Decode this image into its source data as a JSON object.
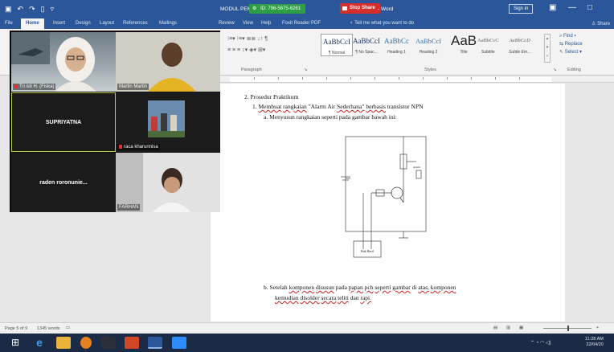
{
  "titlebar": {
    "doc_title": "MODUL PEMB",
    "zoom_pill": "ID: 796-5875-6261",
    "share_pill": "Stop Share",
    "word_suffix": "- Word",
    "signin": "Sign in",
    "minimize": "—",
    "restore": "□"
  },
  "tabs": [
    "File",
    "Home",
    "Insert",
    "Design",
    "Layout",
    "References",
    "Mailings",
    "Review",
    "View",
    "Help",
    "Foxit Reader PDF"
  ],
  "tellme": "Tell me what you want to do",
  "share": "Share",
  "ribbon": {
    "paragraph_label": "Paragraph",
    "styles_label": "Styles",
    "editing_label": "Editing",
    "styles": [
      {
        "sample": "AaBbCcI",
        "name": "¶ Normal"
      },
      {
        "sample": "AaBbCcI",
        "name": "¶ No Spac..."
      },
      {
        "sample": "AaBbCc",
        "name": "Heading 1"
      },
      {
        "sample": "AaBbCcI",
        "name": "Heading 2"
      },
      {
        "sample": "AaB",
        "name": "Title"
      },
      {
        "sample": "AaBbCcC",
        "name": "Subtitle"
      },
      {
        "sample": "AaBbCcD",
        "name": "Subtle Em..."
      }
    ],
    "editing": [
      "Find",
      "Replace",
      "Select"
    ]
  },
  "document": {
    "heading": "2.  Prosedur Praktikum",
    "item1_num": "1.",
    "item1_a": "Membuat",
    "item1_b": "rangkaian",
    "item1_c": "\"Alarm Air",
    "item1_d": "Sederhana\"",
    "item1_e": "berbasis",
    "item1_f": "transistor NPN",
    "sub_a": "a.  Menyusun rangkaian seperti pada gambar bawah ini:",
    "circuit_box": "Bak Hasil",
    "circuit_alarm": "Alarm",
    "sub_b_prefix": "b.  Setelah",
    "sub_b_1": "komponen",
    "sub_b_2": "disusun",
    "sub_b_3": "pada",
    "sub_b_4": "papan",
    "sub_b_5": "pcb",
    "sub_b_6": "seperti",
    "sub_b_7": "gambar",
    "sub_b_8": "di",
    "sub_b_9": "atas,",
    "sub_b_10": "komponen",
    "line2_1": "kemudian",
    "line2_2": "disolder",
    "line2_3": "secara",
    "line2_4": "teliti",
    "line2_5": "dan",
    "line2_6": "rapi."
  },
  "video": {
    "tiles": [
      {
        "name": "Tri isti H. (Fiska)",
        "muted": true
      },
      {
        "name": "Martin Martin",
        "muted": false
      },
      {
        "name": "SUPRIYATNA"
      },
      {
        "name": "raca kharunnisa",
        "muted": true
      },
      {
        "name": "raden roronunie..."
      },
      {
        "name": "FARHAN",
        "muted": false
      }
    ]
  },
  "status": {
    "page": "Page 5 of 9",
    "words": "1345 words"
  },
  "clock": {
    "time": "11:28 AM",
    "date": "22/04/20"
  }
}
